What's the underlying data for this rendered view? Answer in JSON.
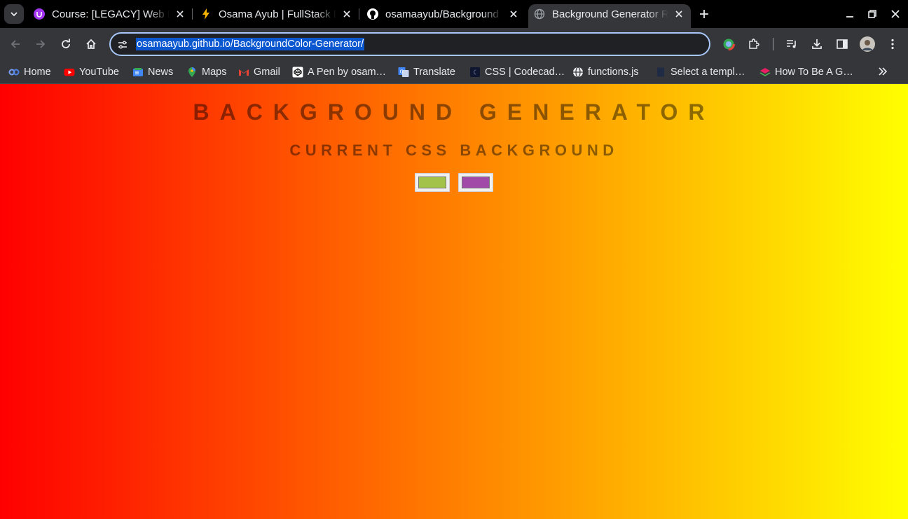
{
  "tabs": [
    {
      "title": "Course: [LEGACY] Web D",
      "favicon": "udemy-icon"
    },
    {
      "title": "Osama Ayub | FullStack D",
      "favicon": "lightning-icon"
    },
    {
      "title": "osamaayub/Background",
      "favicon": "github-icon"
    },
    {
      "title": "Background Generator R",
      "favicon": "globe-icon",
      "active": true
    }
  ],
  "address_bar": {
    "url": "osamaayub.github.io/BackgroundColor-Generator/"
  },
  "bookmarks": [
    {
      "label": "Home",
      "icon": "home-icon"
    },
    {
      "label": "YouTube",
      "icon": "youtube-icon"
    },
    {
      "label": "News",
      "icon": "google-news-icon"
    },
    {
      "label": "Maps",
      "icon": "maps-pin-icon"
    },
    {
      "label": "Gmail",
      "icon": "gmail-icon"
    },
    {
      "label": "A Pen by osam…",
      "icon": "codepen-icon"
    },
    {
      "label": "Translate",
      "icon": "translate-icon"
    },
    {
      "label": "CSS | Codecad…",
      "icon": "codecademy-icon"
    },
    {
      "label": "functions.js",
      "icon": "globe-icon"
    },
    {
      "label": "Select a templ…",
      "icon": "page-icon"
    },
    {
      "label": "How To Be A G…",
      "icon": "stack-icon"
    }
  ],
  "page": {
    "heading": "Background Generator",
    "subheading": "Current CSS Background",
    "color1": "#a3c24a",
    "color2": "#a24aa8",
    "gradient_start": "#ff0000",
    "gradient_end": "#ffff00"
  }
}
